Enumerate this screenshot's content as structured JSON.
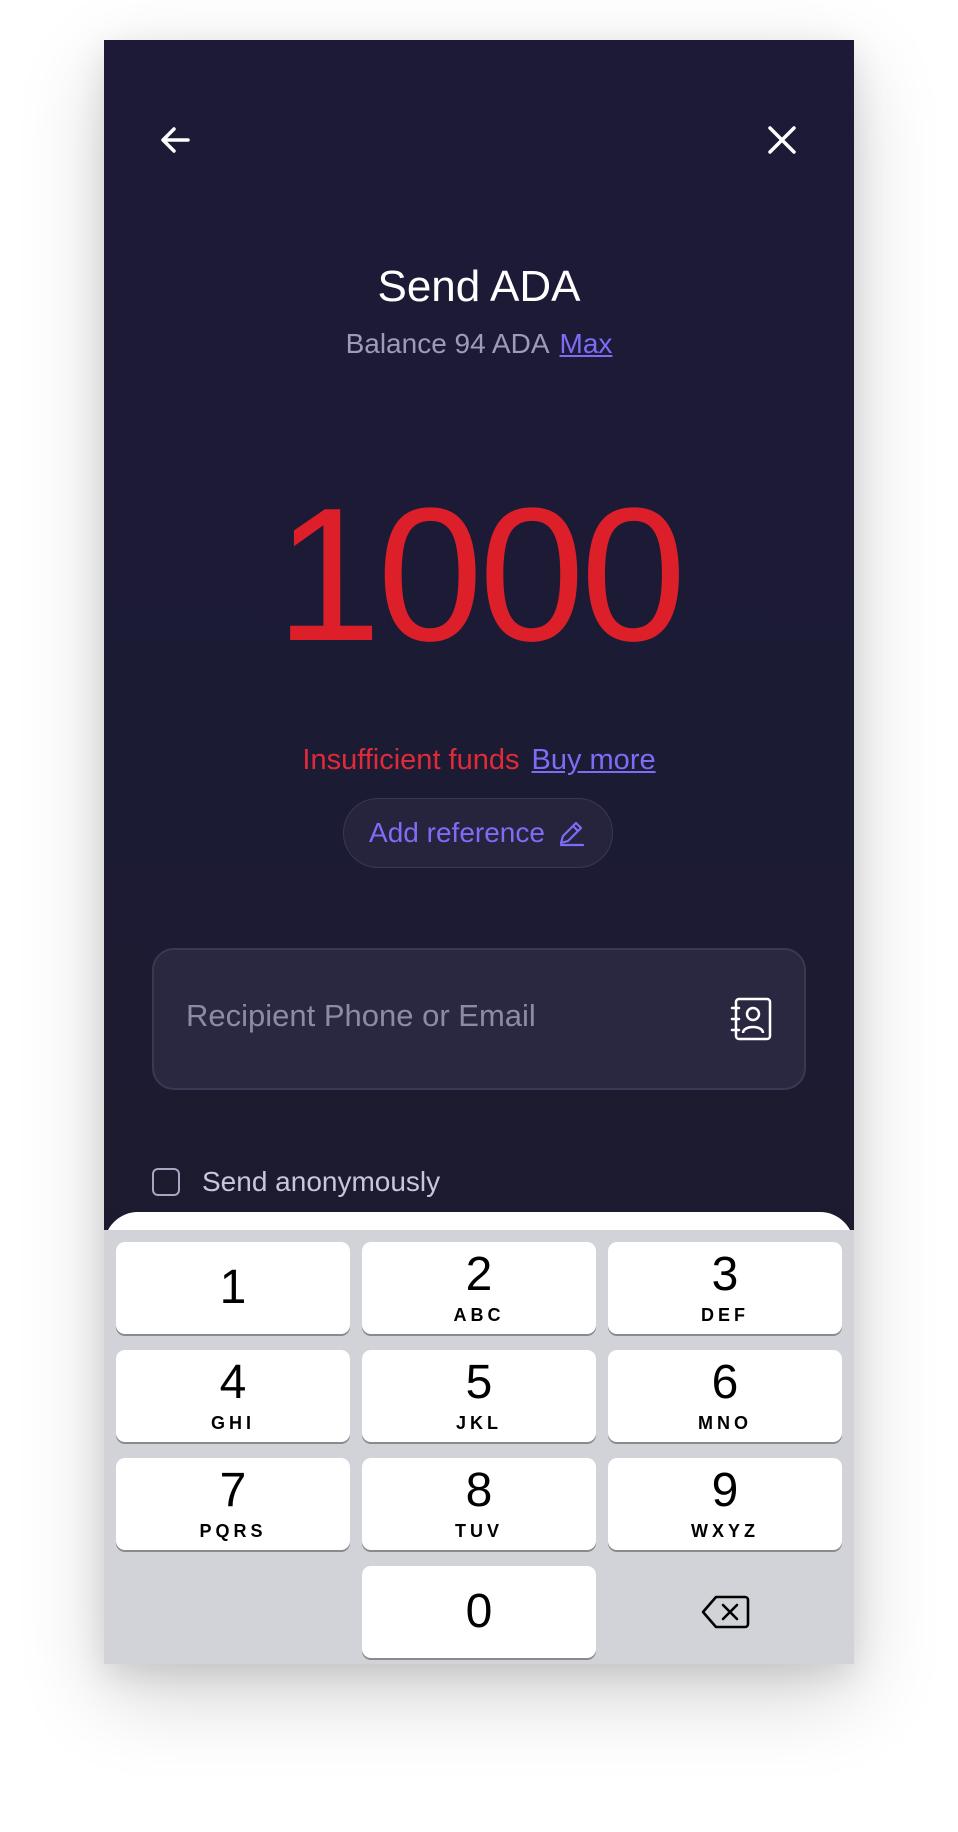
{
  "header": {
    "title": "Send ADA",
    "balance_text": "Balance 94 ADA",
    "max_label": "Max"
  },
  "amount": {
    "value": "1000",
    "color": "#dd1f2a"
  },
  "funds": {
    "error_text": "Insufficient funds",
    "buy_more_label": "Buy more"
  },
  "reference": {
    "label": "Add reference"
  },
  "recipient": {
    "placeholder": "Recipient Phone or Email"
  },
  "anonymous": {
    "label": "Send anonymously",
    "checked": false
  },
  "keypad": {
    "keys": [
      {
        "num": "1",
        "letters": ""
      },
      {
        "num": "2",
        "letters": "ABC"
      },
      {
        "num": "3",
        "letters": "DEF"
      },
      {
        "num": "4",
        "letters": "GHI"
      },
      {
        "num": "5",
        "letters": "JKL"
      },
      {
        "num": "6",
        "letters": "MNO"
      },
      {
        "num": "7",
        "letters": "PQRS"
      },
      {
        "num": "8",
        "letters": "TUV"
      },
      {
        "num": "9",
        "letters": "WXYZ"
      },
      {
        "num": "0",
        "letters": ""
      }
    ]
  },
  "colors": {
    "accent": "#7d6cf5",
    "error": "#e02a37",
    "background": "#1d1a38"
  },
  "icons": {
    "back": "arrow-left-icon",
    "close": "close-icon",
    "edit": "pencil-icon",
    "contacts": "contact-book-icon",
    "delete": "backspace-icon"
  }
}
